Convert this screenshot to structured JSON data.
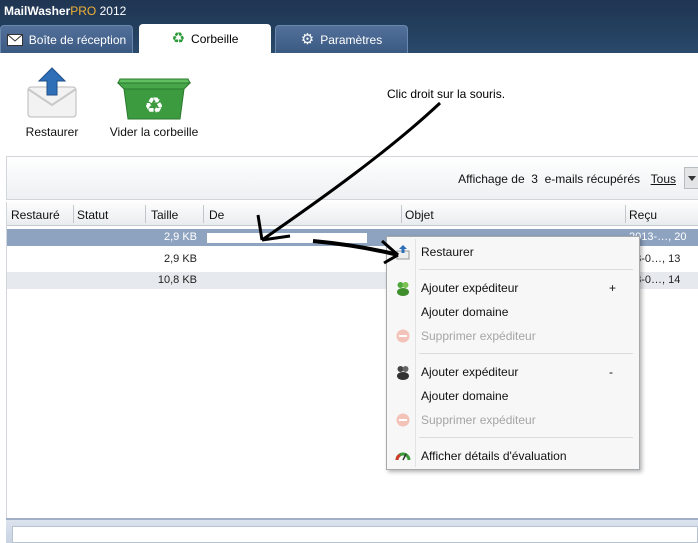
{
  "app": {
    "name": "MailWasher",
    "edition": "PRO",
    "year": "2012"
  },
  "tabs": [
    {
      "label": "Boîte de réception",
      "icon": "inbox-icon"
    },
    {
      "label": "Corbeille",
      "icon": "recycle-icon"
    },
    {
      "label": "Paramètres",
      "icon": "gear-icon"
    }
  ],
  "toolbar": {
    "restore_label": "Restaurer",
    "empty_label": "Vider la corbeille"
  },
  "annotation": "Clic droit sur la souris.",
  "infobar": {
    "text": "Affichage de  3  e-mails récupérés",
    "filter": "Tous"
  },
  "columns": [
    "Restauré",
    "Statut",
    "Taille",
    "De",
    "Objet",
    "Reçu"
  ],
  "rows": [
    {
      "size": "2,9 KB",
      "received": "2013-…, 20"
    },
    {
      "size": "2,9 KB",
      "received": "13-0…, 13"
    },
    {
      "size": "10,8 KB",
      "received": "13-0…, 14"
    }
  ],
  "context_menu": {
    "restore": "Restaurer",
    "add_sender_1": "Ajouter expéditeur",
    "add_sender_1_shortcut": "+",
    "add_domain_1": "Ajouter domaine",
    "remove_sender_1": "Supprimer expéditeur",
    "add_sender_2": "Ajouter expéditeur",
    "add_sender_2_shortcut": "-",
    "add_domain_2": "Ajouter domaine",
    "remove_sender_2": "Supprimer expéditeur",
    "details": "Afficher détails d'évaluation"
  },
  "colors": {
    "titlebar": "#24405f",
    "selected_row": "#8ea3c0",
    "accent": "#f2b233"
  }
}
